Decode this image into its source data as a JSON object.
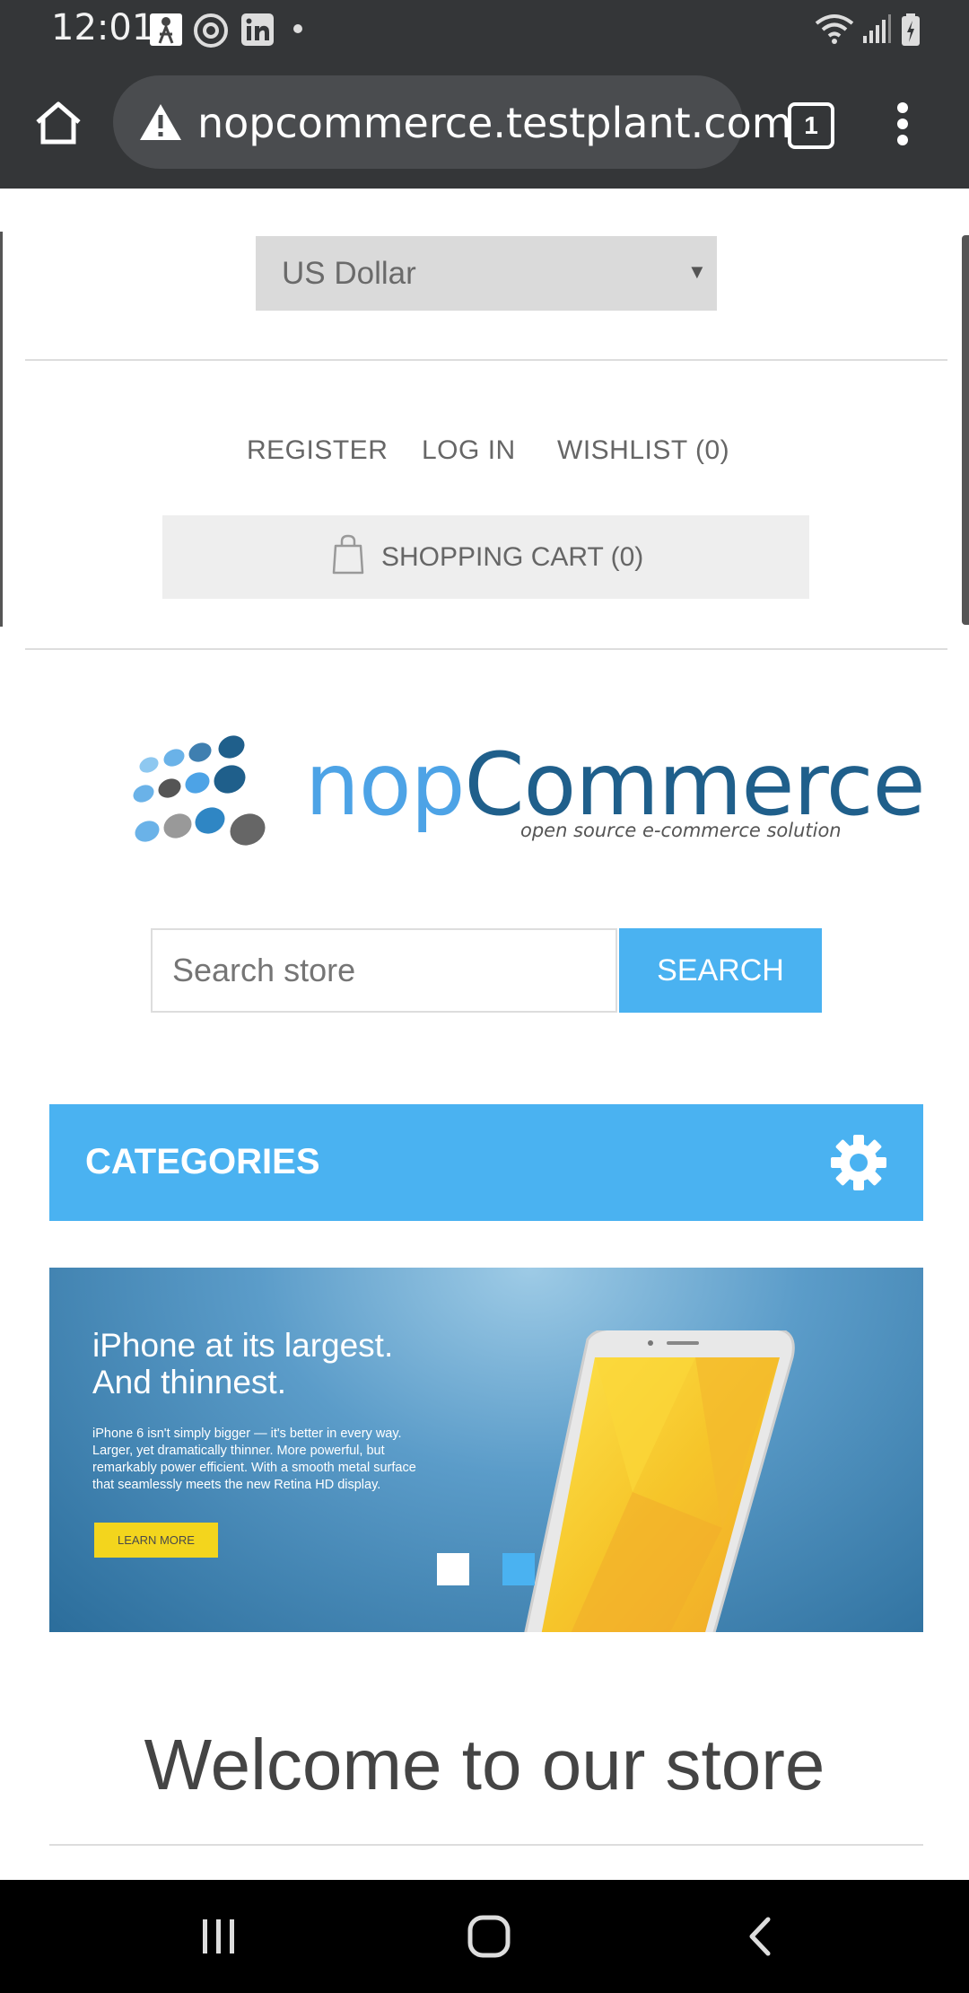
{
  "status_bar": {
    "time": "12:01",
    "icons": [
      "notification-app-icon",
      "threads-icon",
      "linkedin-icon",
      "dot-icon",
      "wifi-icon",
      "signal-icon",
      "battery-icon"
    ]
  },
  "browser": {
    "url": "nopcommerce.testplant.com",
    "tab_count": "1",
    "icons": [
      "home-icon",
      "warning-icon",
      "tabs-icon",
      "more-icon"
    ]
  },
  "header": {
    "currency": {
      "selected": "US Dollar",
      "options": [
        "US Dollar"
      ]
    },
    "links": {
      "register": "REGISTER",
      "login": "LOG IN",
      "wishlist": "WISHLIST (0)"
    },
    "cart": "SHOPPING CART (0)"
  },
  "logo": {
    "brand_prefix": "nop",
    "brand_suffix": "Commerce",
    "tagline": "open source e-commerce solution"
  },
  "search": {
    "placeholder": "Search store",
    "button": "SEARCH"
  },
  "categories": {
    "label": "CATEGORIES"
  },
  "banner": {
    "headline_line1": "iPhone at its largest.",
    "headline_line2": "And thinnest.",
    "body": "iPhone 6 isn't simply bigger — it's better in every way. Larger, yet dramatically thinner. More powerful, but remarkably power efficient. With a smooth metal surface that seamlessly meets the new Retina HD display.",
    "cta": "LEARN MORE",
    "slide_count": 2,
    "active_slide": 2
  },
  "welcome": "Welcome to our store",
  "colors": {
    "accent": "#4ab2f1",
    "toolbar": "#343638",
    "cta": "#f3d51d"
  }
}
